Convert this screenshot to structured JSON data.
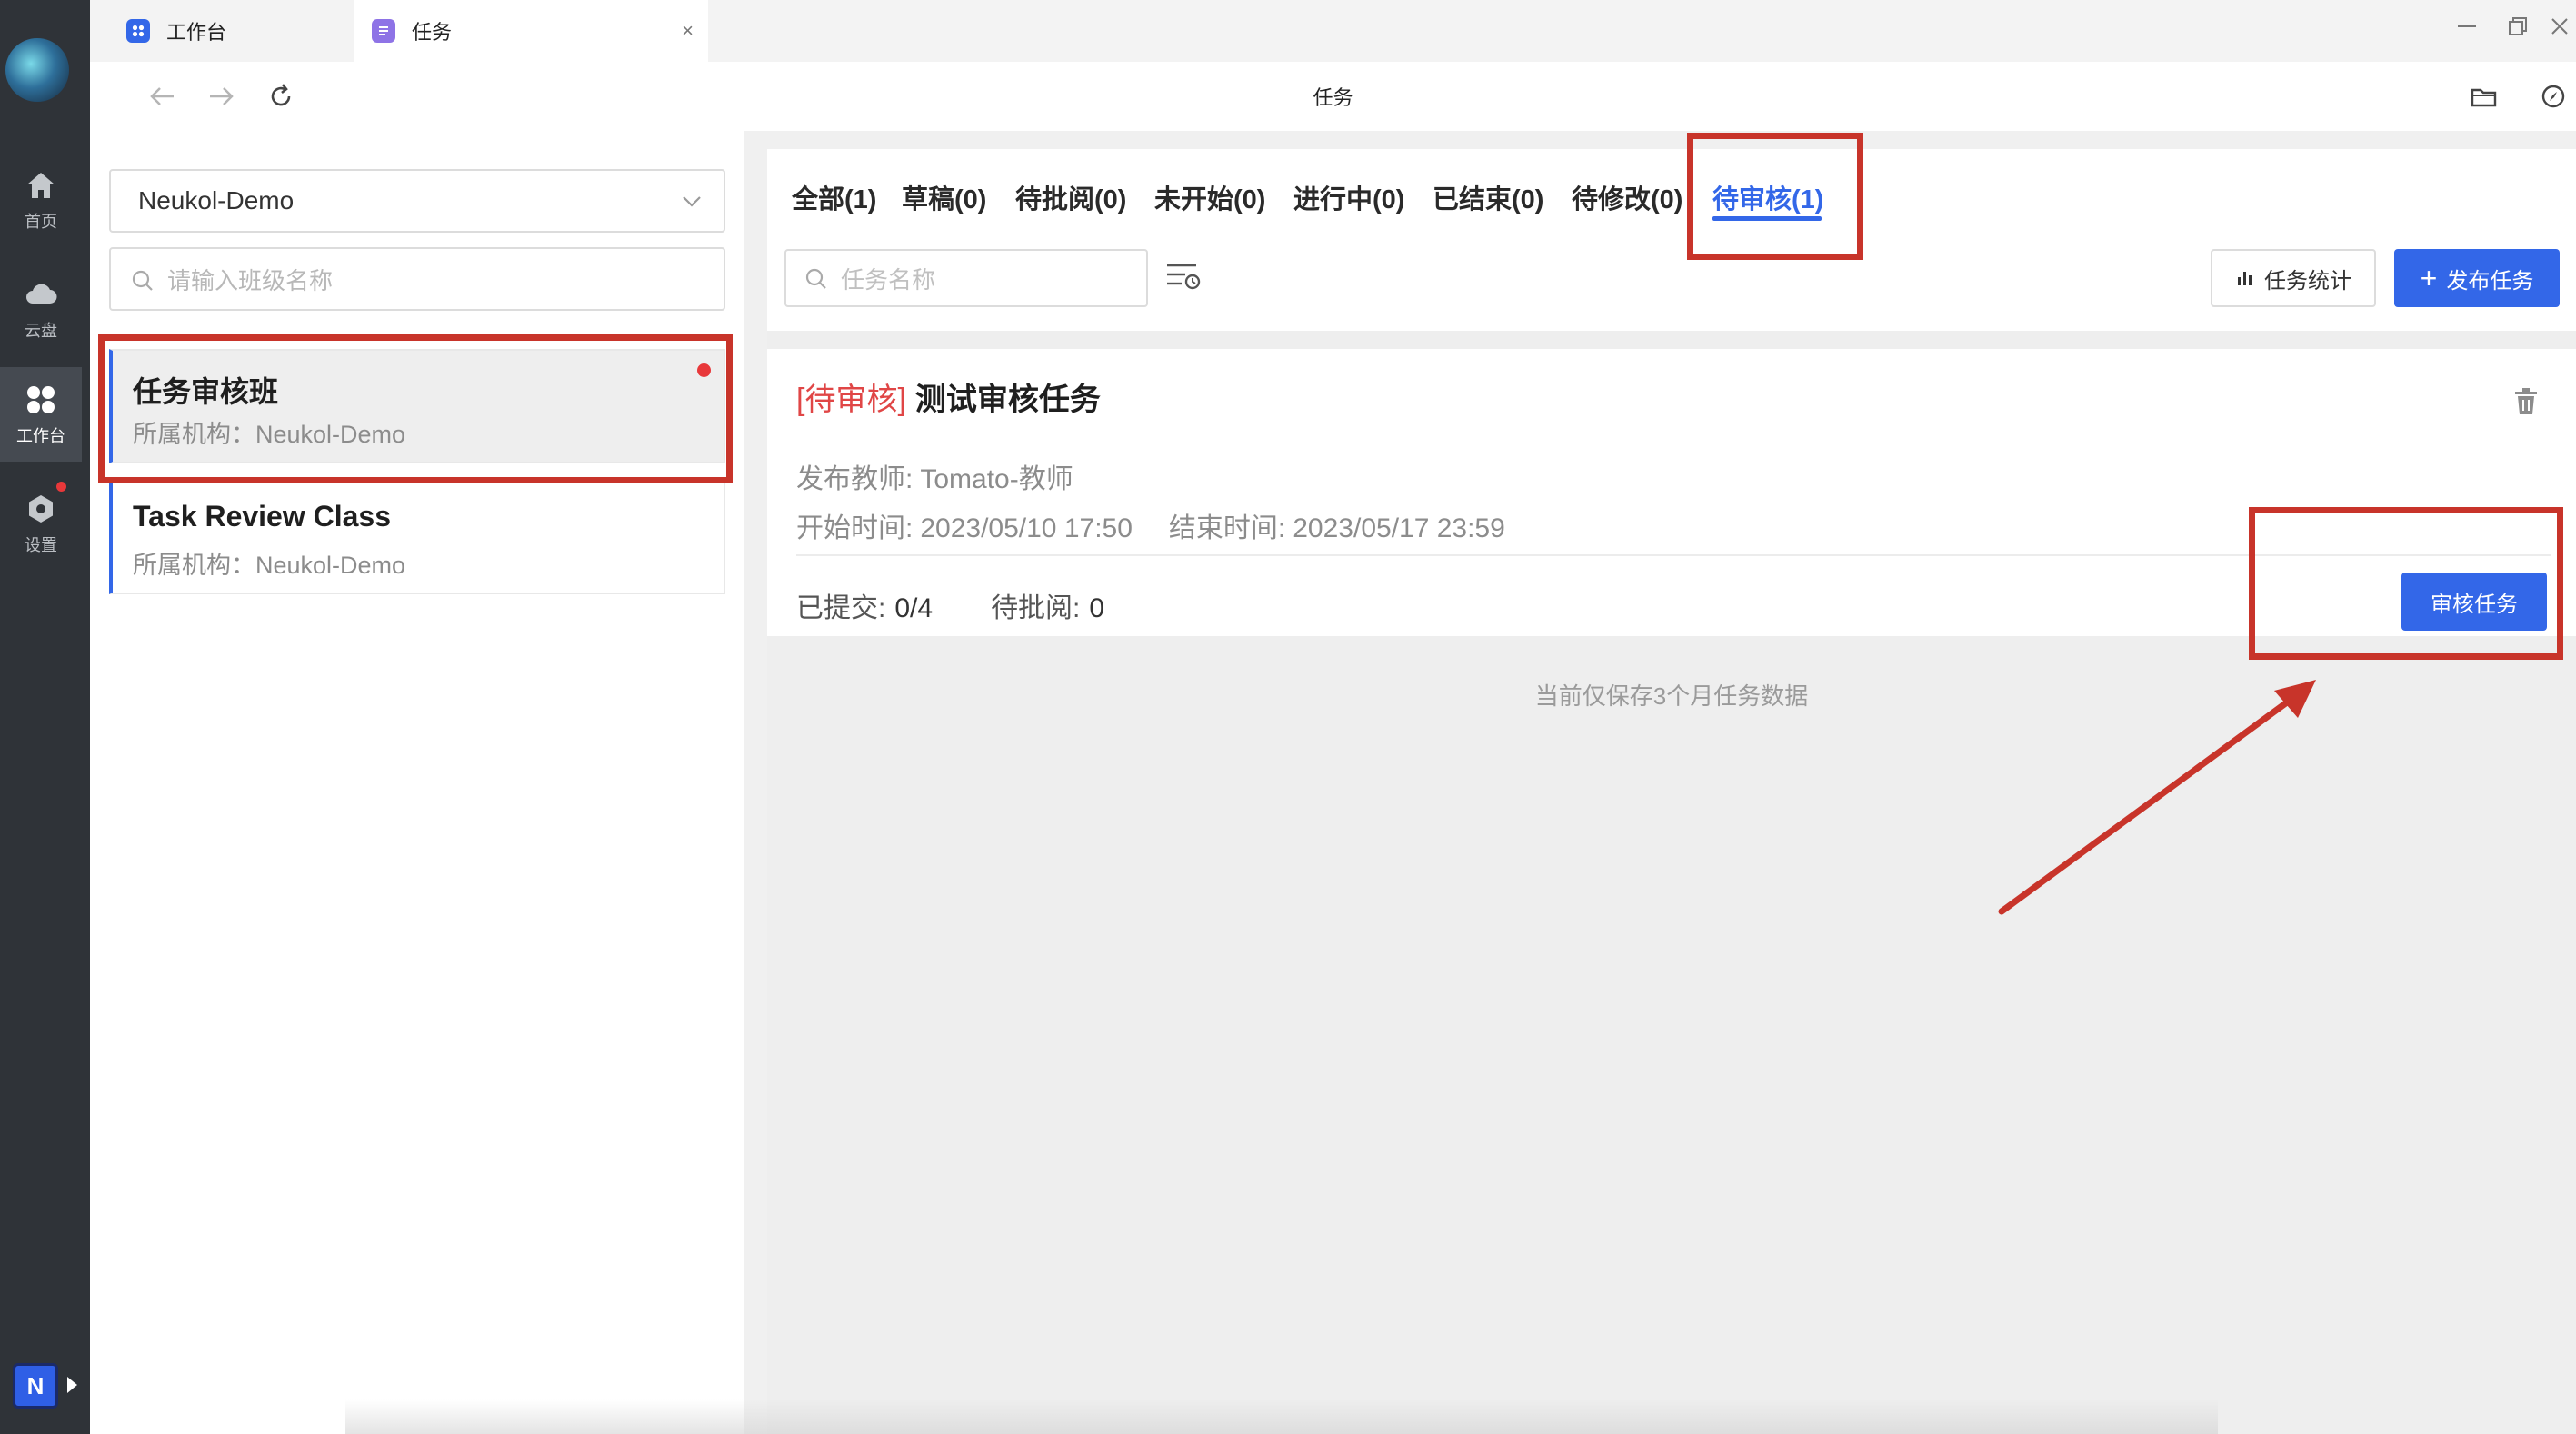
{
  "rail": {
    "items": [
      {
        "label": "首页",
        "icon": "home-icon"
      },
      {
        "label": "云盘",
        "icon": "cloud-icon"
      },
      {
        "label": "工作台",
        "icon": "workbench-icon"
      },
      {
        "label": "设置",
        "icon": "settings-icon"
      }
    ],
    "badge_letter": "N"
  },
  "tabs": [
    {
      "label": "工作台",
      "icon": "workbench-tab-icon"
    },
    {
      "label": "任务",
      "icon": "task-tab-icon",
      "close": "×"
    }
  ],
  "nav": {
    "title": "任务"
  },
  "left": {
    "org_select": "Neukol-Demo",
    "search_placeholder": "请输入班级名称",
    "classes": [
      {
        "name": "任务审核班",
        "org": "所属机构：Neukol-Demo"
      },
      {
        "name": "Task Review Class",
        "org": "所属机构：Neukol-Demo"
      }
    ]
  },
  "filters": [
    "全部(1)",
    "草稿(0)",
    "待批阅(0)",
    "未开始(0)",
    "进行中(0)",
    "已结束(0)",
    "待修改(0)",
    "待审核(1)"
  ],
  "toolbar": {
    "search_placeholder": "任务名称",
    "stats_label": "任务统计",
    "publish_label": "发布任务",
    "publish_plus": "+"
  },
  "task": {
    "status": "[待审核]",
    "title": "测试审核任务",
    "teacher_label": "发布教师:",
    "teacher": "Tomato-教师",
    "start_label": "开始时间:",
    "start": "2023/05/10 17:50",
    "end_label": "结束时间:",
    "end": "2023/05/17 23:59",
    "submitted_label": "已提交:",
    "submitted": "0/4",
    "pending_label": "待批阅:",
    "pending": "0",
    "review_label": "审核任务"
  },
  "footnote": "当前仅保存3个月任务数据",
  "colors": {
    "accent": "#3367e8",
    "annotation": "#c8342a",
    "status_red": "#e04646",
    "rail_bg": "#2f3338"
  }
}
